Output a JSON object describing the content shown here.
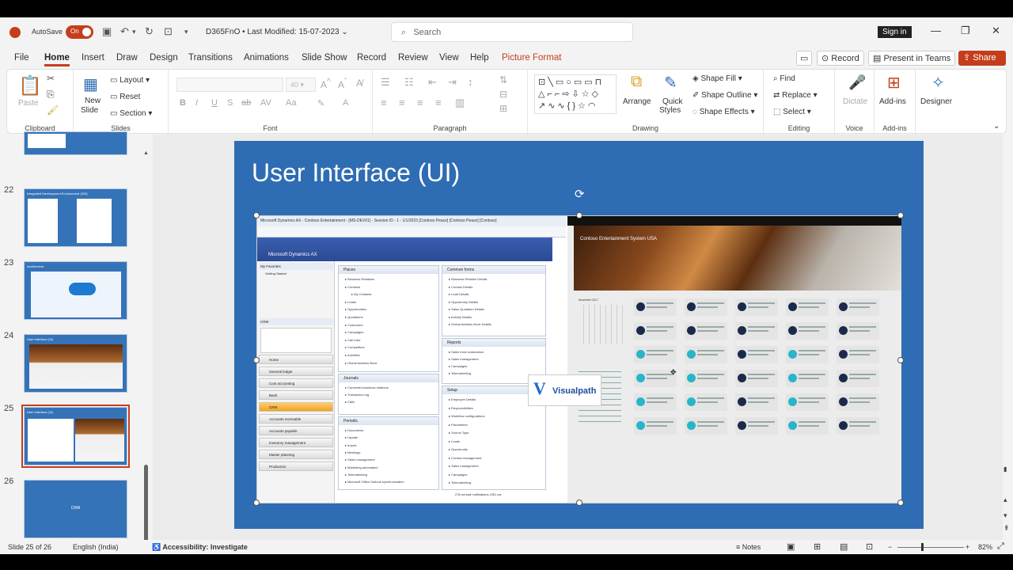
{
  "titlebar": {
    "autosave_label": "AutoSave",
    "autosave_state": "On",
    "doc_title": "D365FnO • Last Modified: 15-07-2023",
    "search_placeholder": "Search",
    "signin_label": "Sign in"
  },
  "tabs": [
    "File",
    "Home",
    "Insert",
    "Draw",
    "Design",
    "Transitions",
    "Animations",
    "Slide Show",
    "Record",
    "Review",
    "View",
    "Help",
    "Picture Format"
  ],
  "active_tab": "Home",
  "tab_right": {
    "record_label": "Record",
    "present_label": "Present in Teams",
    "share_label": "Share"
  },
  "ribbon": {
    "clipboard": {
      "paste": "Paste",
      "group": "Clipboard"
    },
    "slides": {
      "new_slide": "New",
      "new_slide2": "Slide",
      "layout": "Layout",
      "reset": "Reset",
      "section": "Section",
      "group": "Slides"
    },
    "font": {
      "group": "Font"
    },
    "paragraph": {
      "group": "Paragraph"
    },
    "drawing": {
      "arrange": "Arrange",
      "quick_styles": "Quick",
      "quick_styles2": "Styles",
      "shape_fill": "Shape Fill",
      "shape_outline": "Shape Outline",
      "shape_effects": "Shape Effects",
      "group": "Drawing"
    },
    "editing": {
      "find": "Find",
      "replace": "Replace",
      "select": "Select",
      "group": "Editing"
    },
    "voice": {
      "dictate": "Dictate",
      "group": "Voice"
    },
    "addins": {
      "addins": "Add-ins",
      "group": "Add-ins"
    },
    "designer": {
      "label": "Designer"
    }
  },
  "thumbnails": [
    {
      "num": "",
      "title": ""
    },
    {
      "num": "22",
      "title": "Integrated Development Environment (IDE)"
    },
    {
      "num": "23",
      "title": "Architecture"
    },
    {
      "num": "24",
      "title": "User Interface (UI)"
    },
    {
      "num": "25",
      "title": "User Interface (UI)"
    },
    {
      "num": "26",
      "title": "",
      "label": "CRM"
    }
  ],
  "selected_slide": "25",
  "slide": {
    "title": "User Interface (UI)"
  },
  "ax": {
    "titlebar": "Microsoft Dynamics AX - Contoso Entertainment - [MS-DEV01] - Session ID - 1 - 1/1/2023 [Contoso Peace] [Contoso Peace] [Contoso]",
    "band_label": "Microsoft Dynamics AX",
    "favorites": "My Favorites",
    "getting_started": "Getting Started",
    "crm": "CRM",
    "nav": [
      "Home",
      "General ledger",
      "Cost accounting",
      "Bank",
      "CRM",
      "Accounts receivable",
      "Accounts payable",
      "Inventory management",
      "Master planning",
      "Production"
    ],
    "nav_selected": "CRM",
    "places_title": "Places",
    "places": [
      "Business Relations",
      "Contacts",
      "My Contacts",
      "Leads",
      "Opportunities",
      "Quotations",
      "Customers",
      "Campaigns",
      "Call Lists",
      "Competitors",
      "Activities",
      "Global Address Book"
    ],
    "common_title": "Common forms",
    "common": [
      "Business Relation Details",
      "Contact Details",
      "Lead Details",
      "Opportunity Details",
      "Sales Quotation Details",
      "Activity Details",
      "Global Address Book Details"
    ],
    "reports_title": "Reports",
    "reports": [
      "Sales force automation",
      "Sales management",
      "Campaigns",
      "Telemarketing"
    ],
    "journals_title": "Journals",
    "journals": [
      "Converted business relations",
      "Transaction log",
      "Calls"
    ],
    "setup_title": "Setup",
    "setup": [
      "Employee Details",
      "Responsibilities",
      "Workflow configurations",
      "Parameters",
      "Source Type",
      "Leads",
      "Opportunity",
      "Contact management",
      "Sales management",
      "Campaigns",
      "Telemarketing"
    ],
    "periodic_title": "Periodic",
    "periodic": [
      "Documents",
      "Update",
      "Import",
      "Meetings",
      "Sales management",
      "Marketing automation",
      "Telemarketing",
      "Microsoft Office Outlook synchronization"
    ],
    "statusbar": "278 unread notifications   USD   usr"
  },
  "d365": {
    "banner_text": "Contoso Entertainment System USA",
    "calendar_month": "November   2017"
  },
  "logo": {
    "mark": "V",
    "text": "Visualpath"
  },
  "status": {
    "slide_info": "Slide 25 of 26",
    "language": "English (India)",
    "accessibility": "Accessibility: Investigate",
    "notes": "Notes",
    "zoom": "82%"
  },
  "colors": {
    "accent": "#c43e1c",
    "slide_bg": "#2e6db3",
    "ribbon_bg": "#ffffff",
    "app_bg": "#f3f3f3"
  }
}
